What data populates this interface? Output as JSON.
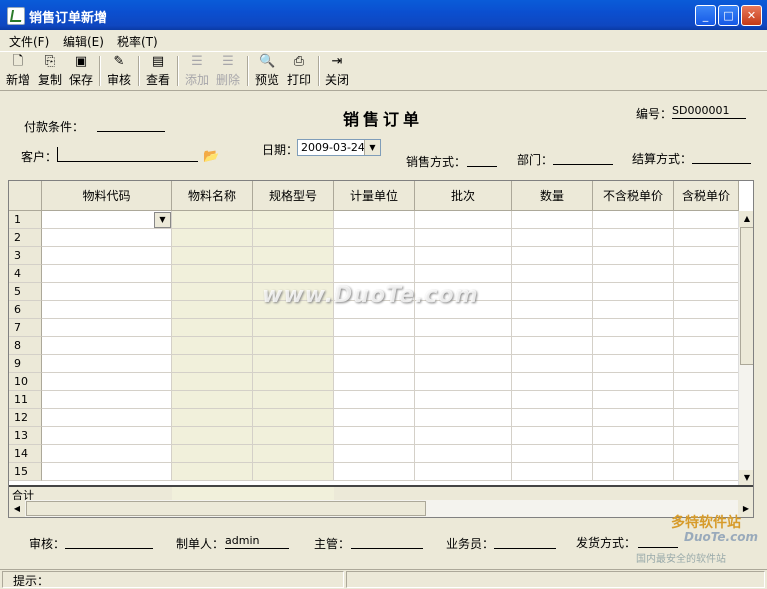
{
  "window": {
    "title": "销售订单新增"
  },
  "titlebar_buttons": {
    "minimize": "_",
    "maximize": "□",
    "close": "✕"
  },
  "menu": [
    "文件(F)",
    "编辑(E)",
    "税率(T)"
  ],
  "toolbar": {
    "new": "新增",
    "copy": "复制",
    "save": "保存",
    "review": "审核",
    "view": "查看",
    "add": "添加",
    "delete": "删除",
    "preview": "预览",
    "print": "打印",
    "close": "关闭"
  },
  "form": {
    "title": "销售订单",
    "payment_terms_label": "付款条件：",
    "number_label": "编号：",
    "number_value": "SD000001",
    "customer_label": "客户：",
    "date_label": "日期：",
    "date_value": "2009-03-24",
    "sales_method_label": "销售方式：",
    "department_label": "部门：",
    "settlement_label": "结算方式："
  },
  "grid": {
    "columns": [
      "物料代码",
      "物料名称",
      "规格型号",
      "计量单位",
      "批次",
      "数量",
      "不含税单价",
      "含税单价"
    ],
    "row_numbers": [
      "1",
      "2",
      "3",
      "4",
      "5",
      "6",
      "7",
      "8",
      "9",
      "10",
      "11",
      "12",
      "13",
      "14",
      "15"
    ],
    "total_label": "合计"
  },
  "footer": {
    "reviewer_label": "审核：",
    "creator_label": "制单人：",
    "creator_value": "admin",
    "supervisor_label": "主管：",
    "salesman_label": "业务员：",
    "shipping_label": "发货方式："
  },
  "status": {
    "hint_label": "提示："
  },
  "watermark": "www.DuoTe.com",
  "corner_logo": {
    "line1": "多特软件站",
    "line2": "DuoTe.com",
    "line3": "国内最安全的软件站"
  }
}
